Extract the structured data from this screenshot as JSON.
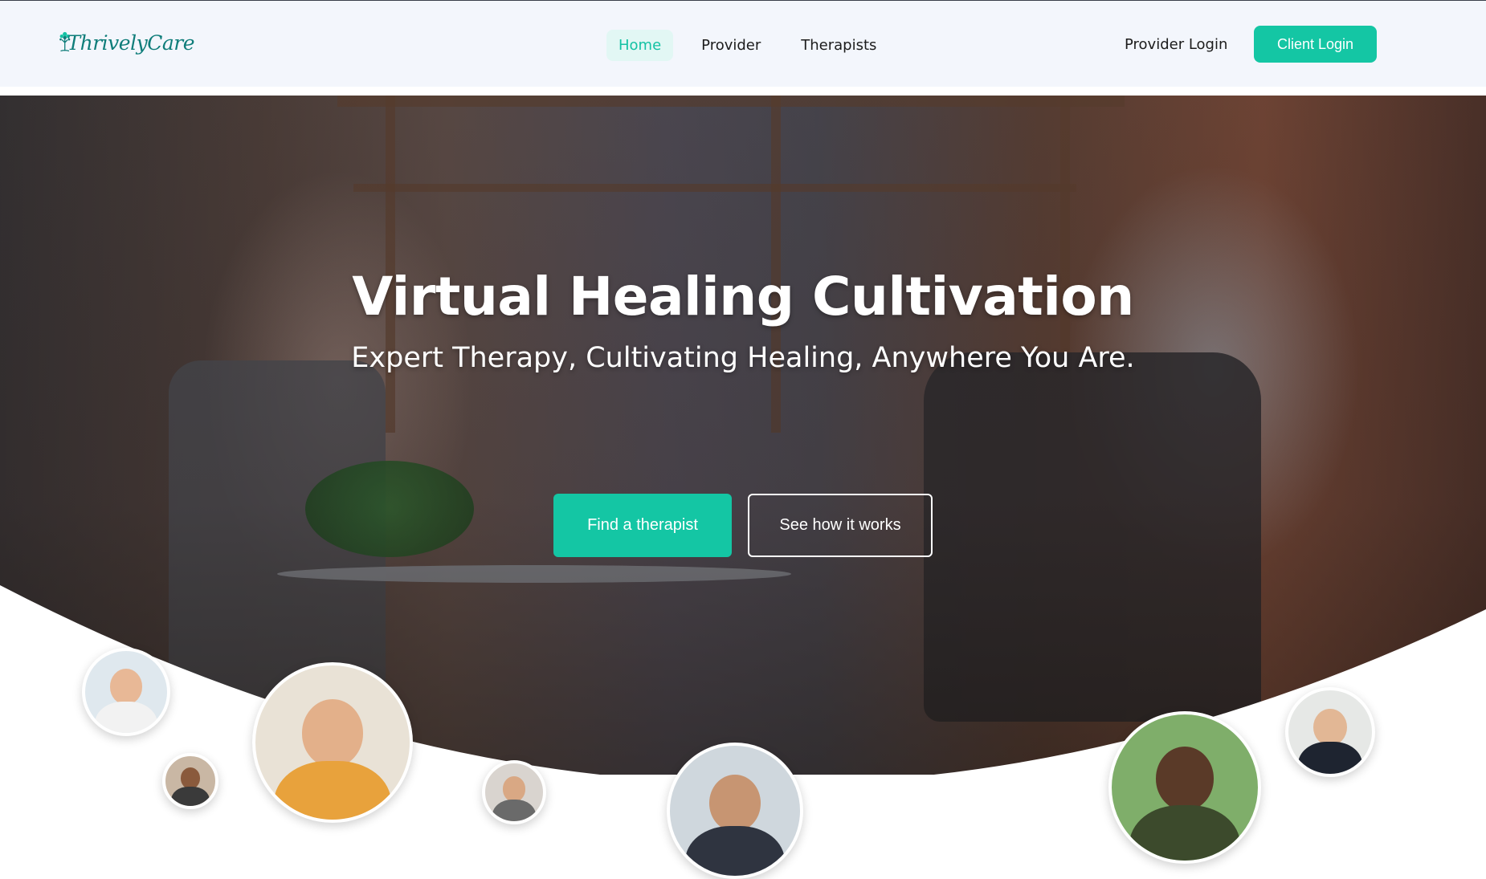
{
  "brand": {
    "name": "ThrivelyCare",
    "colors": {
      "accent": "#14c6a4",
      "logo": "#0f7d7a",
      "header_bg": "#f3f6fc"
    }
  },
  "nav": {
    "items": [
      {
        "label": "Home",
        "active": true
      },
      {
        "label": "Provider",
        "active": false
      },
      {
        "label": "Therapists",
        "active": false
      }
    ],
    "provider_login": "Provider Login",
    "client_login": "Client Login"
  },
  "hero": {
    "title": "Virtual Healing Cultivation",
    "subtitle": "Expert Therapy, Cultivating Healing, Anywhere You Are.",
    "primary_button": "Find a therapist",
    "secondary_button": "See how it works"
  },
  "therapist_avatars": [
    {
      "name": "avatar-1"
    },
    {
      "name": "avatar-2"
    },
    {
      "name": "avatar-3"
    },
    {
      "name": "avatar-4"
    },
    {
      "name": "avatar-5"
    },
    {
      "name": "avatar-6"
    },
    {
      "name": "avatar-7"
    }
  ]
}
